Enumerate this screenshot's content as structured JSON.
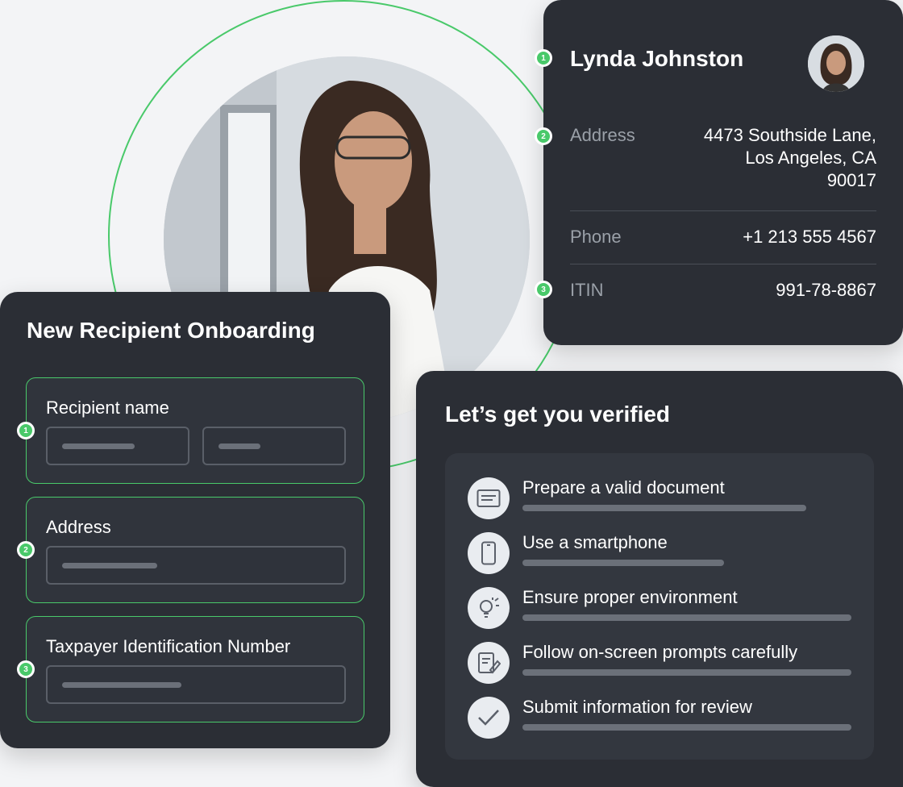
{
  "colors": {
    "background": "#f3f4f6",
    "card": "#2b2e35",
    "accent": "#49c96a"
  },
  "profile": {
    "name": "Lynda Johnston",
    "rows": [
      {
        "label": "Address",
        "value_lines": [
          "4473 Southside Lane,",
          "Los Angeles, CA",
          "90017"
        ]
      },
      {
        "label": "Phone",
        "value": "+1 213 555 4567"
      },
      {
        "label": "ITIN",
        "value": "991-78-8867"
      }
    ],
    "markers": [
      "1",
      "2",
      "3"
    ]
  },
  "onboarding": {
    "title": "New Recipient Onboarding",
    "fields": [
      {
        "label": "Recipient name",
        "marker": "1"
      },
      {
        "label": "Address",
        "marker": "2"
      },
      {
        "label": "Taxpayer Identification Number",
        "marker": "3"
      }
    ]
  },
  "verify": {
    "title": "Let’s get you verified",
    "steps": [
      {
        "label": "Prepare a valid document",
        "icon": "document-icon"
      },
      {
        "label": "Use a smartphone",
        "icon": "smartphone-icon"
      },
      {
        "label": "Ensure proper environment",
        "icon": "lightbulb-icon"
      },
      {
        "label": "Follow on-screen prompts carefully",
        "icon": "edit-note-icon"
      },
      {
        "label": "Submit information for review",
        "icon": "checkmark-icon"
      }
    ]
  }
}
